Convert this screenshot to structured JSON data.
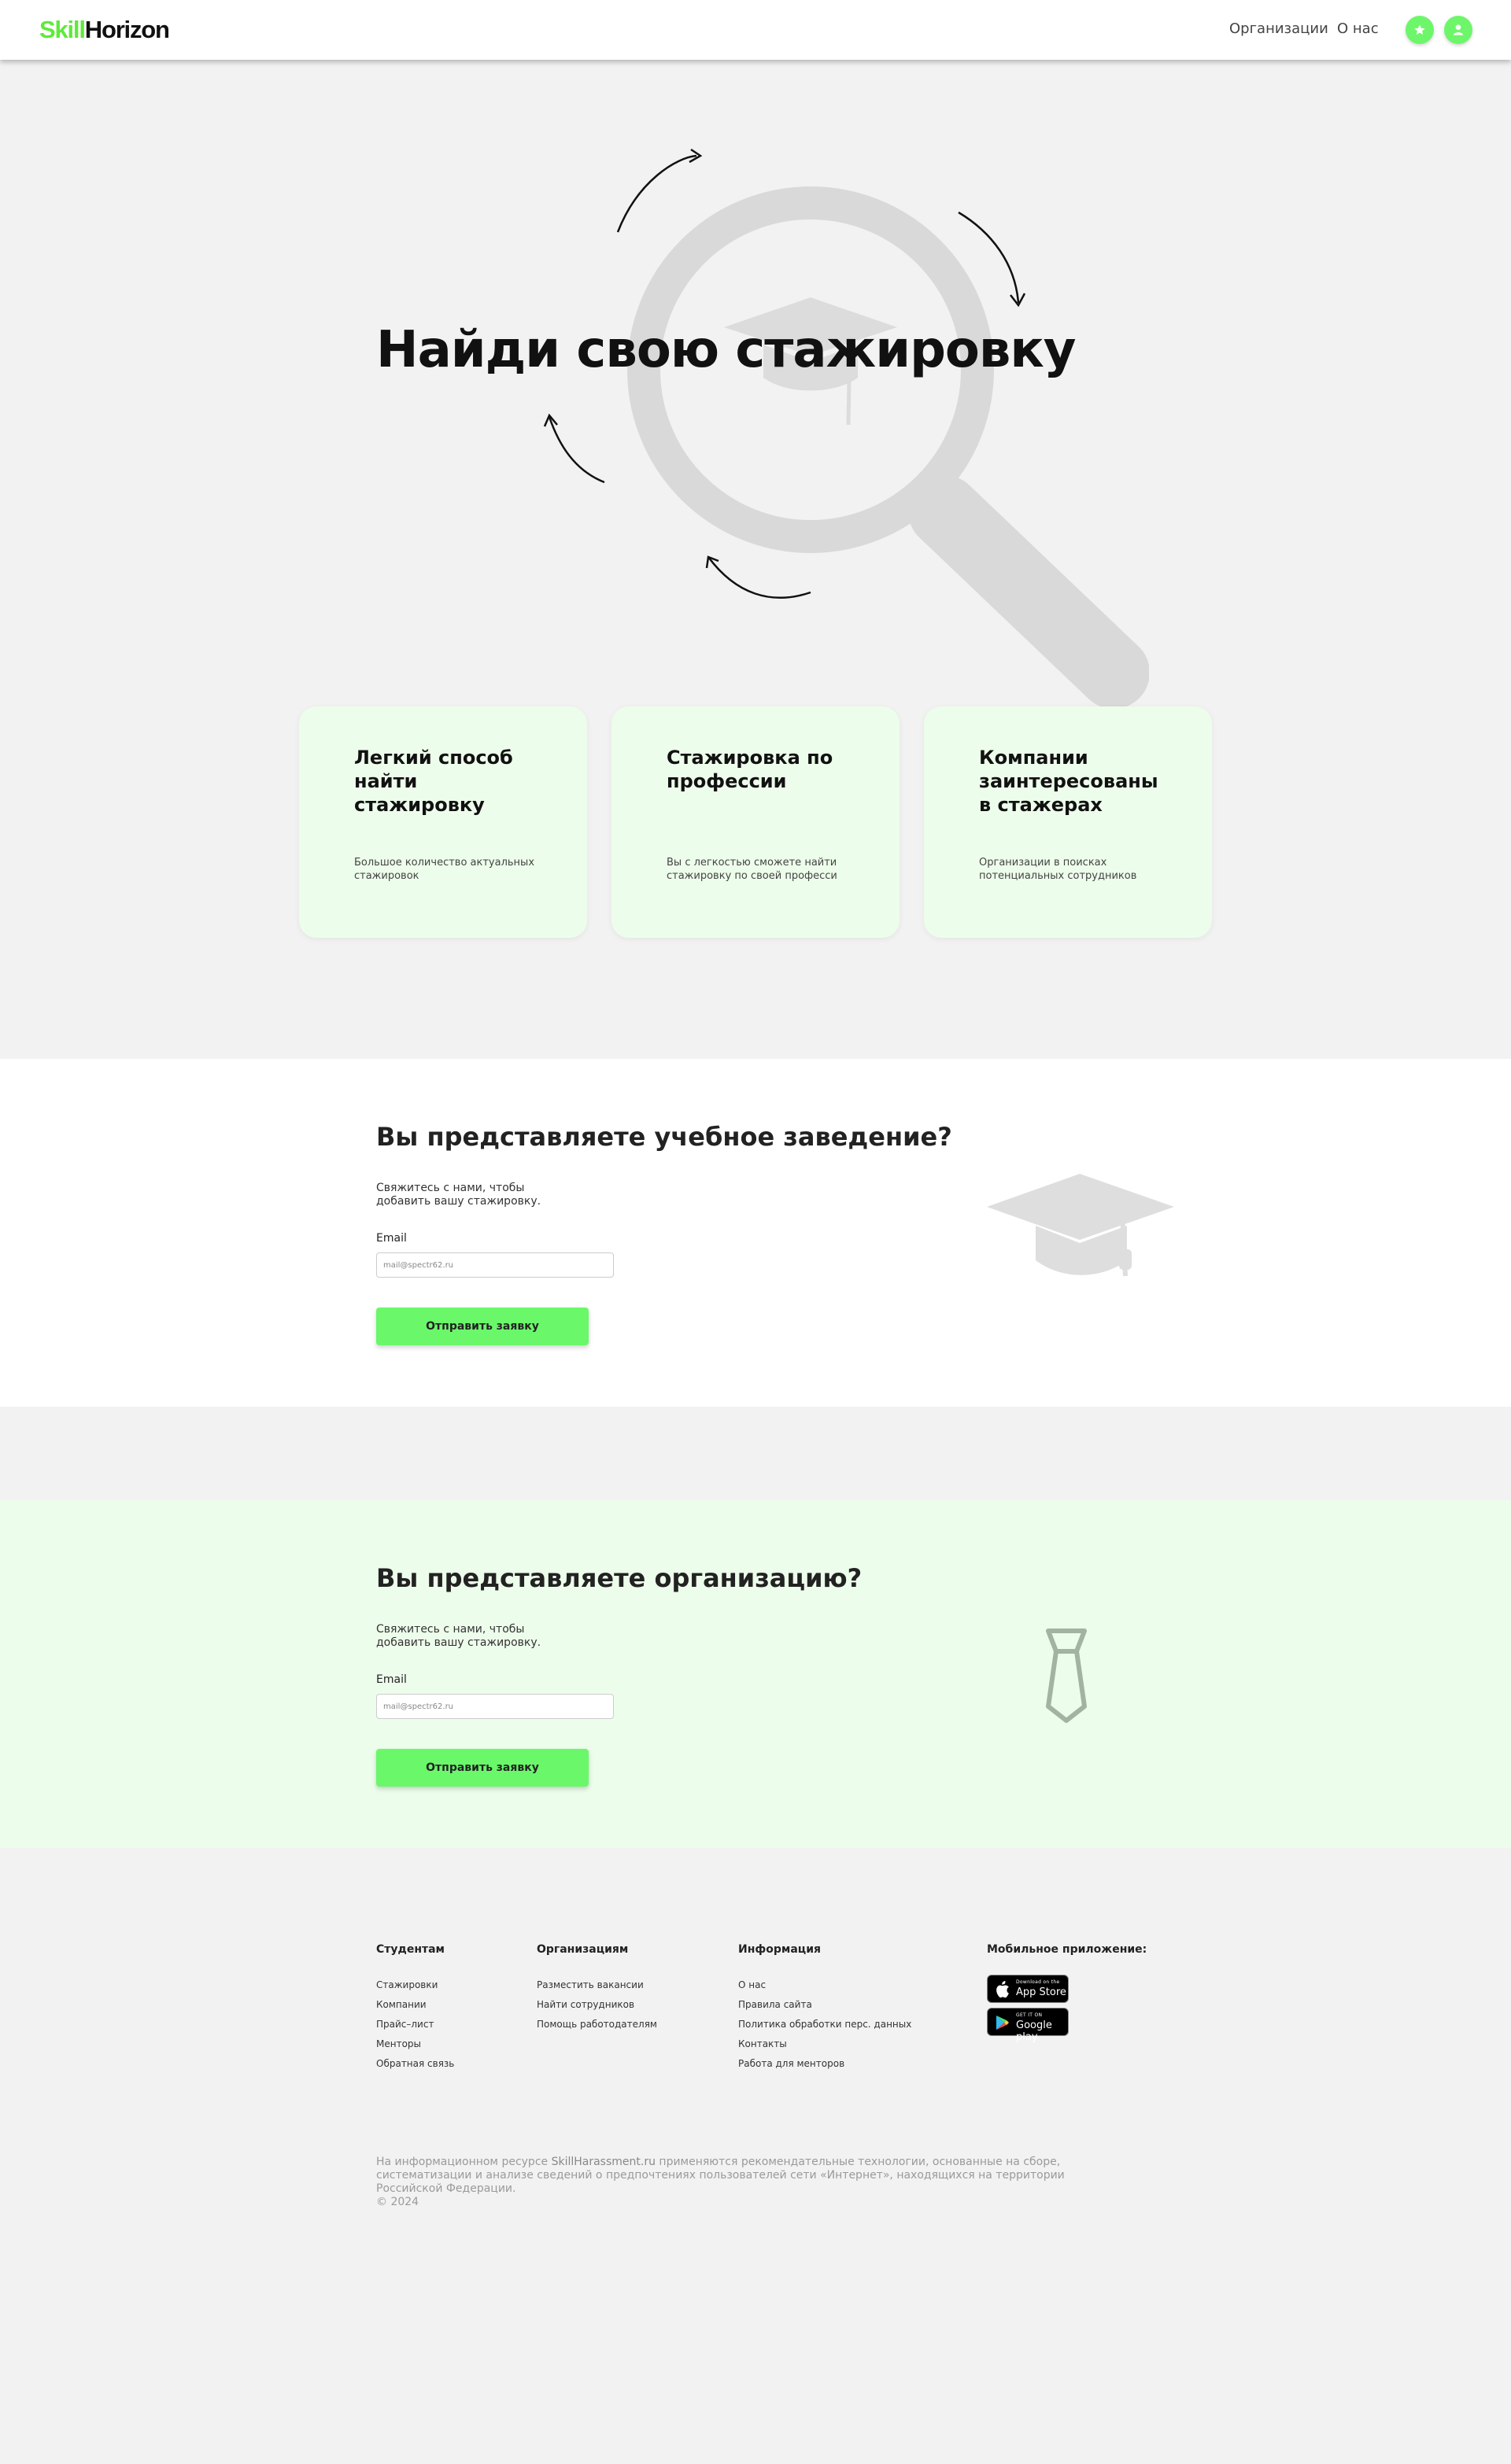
{
  "header": {
    "logo_part1": "Skill",
    "logo_part2": "Horizon",
    "nav": [
      "Организации",
      "О нас"
    ],
    "favorites_icon": "star-icon",
    "profile_icon": "user-icon"
  },
  "hero": {
    "title": "Найди свою стажировку"
  },
  "features": [
    {
      "title": "Легкий способ найти стажировку",
      "description": "Большое количество актуальных стажировок"
    },
    {
      "title": "Стажировка по профессии",
      "description": "Вы с легкостью сможете найти стажировку по своей професси"
    },
    {
      "title": "Компании заинтересованы в стажерах",
      "description": "Организации в поисках потенциальных сотрудников"
    }
  ],
  "education_section": {
    "title": "Вы представляете учебное заведение?",
    "text": "Свяжитесь с нами, чтобы добавить вашу стажировку.",
    "email_label": "Email",
    "email_placeholder": "mail@spectr62.ru",
    "submit_label": "Отправить заявку",
    "icon": "graduation-cap-icon"
  },
  "organization_section": {
    "title": "Вы представляете организацию?",
    "text": "Свяжитесь с нами, чтобы добавить вашу стажировку.",
    "email_label": "Email",
    "email_placeholder": "mail@spectr62.ru",
    "submit_label": "Отправить заявку",
    "icon": "tie-icon"
  },
  "footer": {
    "students": {
      "title": "Студентам",
      "links": [
        "Стажировки",
        "Компании",
        "Прайс–лист",
        "Менторы",
        "Обратная связь"
      ]
    },
    "organizations": {
      "title": "Организациям",
      "links": [
        "Разместить вакансии",
        "Найти сотрудников",
        "Помощь работодателям"
      ]
    },
    "info": {
      "title": "Информация",
      "links": [
        "О нас",
        "Правила сайта",
        "Политика обработки перс. данных",
        "Контакты",
        "Работа для менторов"
      ]
    },
    "mobile": {
      "title": "Мобильное приложение:",
      "app_store_small": "Download on the",
      "app_store": "App Store",
      "google_play_small": "GET IT ON",
      "google_play": "Google play"
    },
    "legal_prefix": "На информационном ресурсе ",
    "legal_site": "SkillHarassment.ru",
    "legal_suffix": " применяются рекомендательные технологии, основанные на сборе, систематизации и анализе сведений о предпочтениях пользователей сети «Интернет», находящихся на территории Российской Федерации.",
    "copyright": "© 2024"
  },
  "colors": {
    "accent": "#6ef66a",
    "logo_green": "#5eea38",
    "card_bg": "#edfdeb",
    "page_bg": "#f2f2f2"
  }
}
